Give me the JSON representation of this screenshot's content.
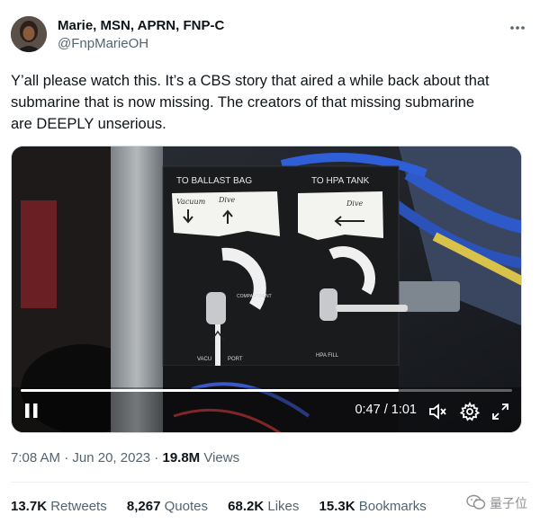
{
  "author": {
    "display_name": "Marie, MSN, APRN, FNP-C",
    "handle": "@FnpMarieOH"
  },
  "more_icon": "more-horizontal-icon",
  "tweet_text": [
    "Y’all please watch this. It’s a CBS story that aired a while back about that",
    "submarine that is now missing. The creators of that missing submarine",
    "are DEEPLY unserious."
  ],
  "video": {
    "panel_labels": {
      "left_header": "TO BALLAST BAG",
      "right_header": "TO HPA TANK",
      "left_tag_1": "Vacuum",
      "left_tag_2": "Dive",
      "right_tag": "Dive",
      "center_label": "COMPARTMENT",
      "bottom_left": "VACU PORT",
      "bottom_right": "HPA FILL"
    },
    "current_time": "0:47",
    "separator": " / ",
    "duration": "1:01",
    "progress_fraction": 0.77,
    "icons": [
      "pause-icon",
      "mute-icon",
      "settings-gear-icon",
      "fullscreen-icon"
    ]
  },
  "meta": {
    "time": "7:08 AM",
    "dot1": " · ",
    "date": "Jun 20, 2023",
    "dot2": " · ",
    "views_count": "19.8M",
    "views_label": " Views"
  },
  "stats": [
    {
      "num": "13.7K",
      "label": " Retweets"
    },
    {
      "num": "8,267",
      "label": " Quotes"
    },
    {
      "num": "68.2K",
      "label": " Likes"
    },
    {
      "num": "15.3K",
      "label": " Bookmarks"
    }
  ],
  "watermark": {
    "text": "量子位",
    "icon": "wechat-icon"
  },
  "colors": {
    "text_primary": "#0f1419",
    "text_secondary": "#536471",
    "border": "#cfd9de"
  }
}
